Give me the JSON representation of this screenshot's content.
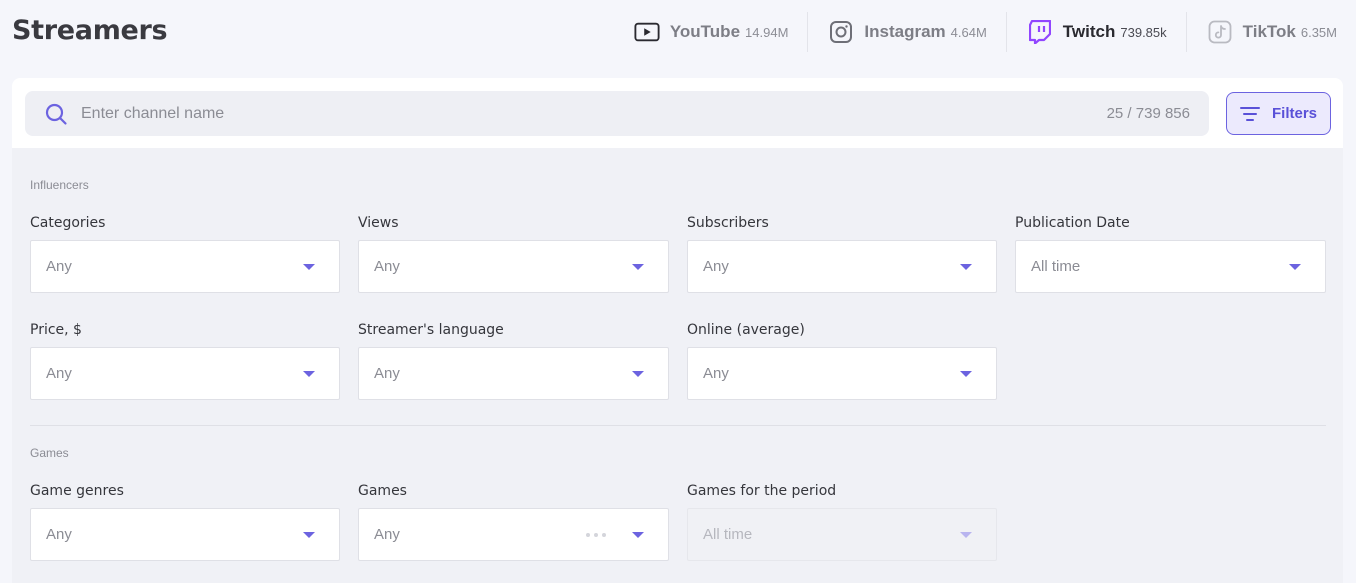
{
  "page_title": "Streamers",
  "platforms": [
    {
      "name": "YouTube",
      "count": "14.94M",
      "icon": "youtube-icon",
      "active": false
    },
    {
      "name": "Instagram",
      "count": "4.64M",
      "icon": "instagram-icon",
      "active": false
    },
    {
      "name": "Twitch",
      "count": "739.85k",
      "icon": "twitch-icon",
      "active": true
    },
    {
      "name": "TikTok",
      "count": "6.35M",
      "icon": "tiktok-icon",
      "active": false
    }
  ],
  "search": {
    "placeholder": "Enter channel name",
    "value": "",
    "count": "25 / 739 856"
  },
  "filters_button": {
    "label": "Filters",
    "accent": "#6c63e0"
  },
  "influencers": {
    "section_label": "Influencers",
    "fields": [
      {
        "label": "Categories",
        "value": "Any"
      },
      {
        "label": "Views",
        "value": "Any"
      },
      {
        "label": "Subscribers",
        "value": "Any"
      },
      {
        "label": "Publication Date",
        "value": "All time"
      },
      {
        "label": "Price, $",
        "value": "Any"
      },
      {
        "label": "Streamer's language",
        "value": "Any"
      },
      {
        "label": "Online (average)",
        "value": "Any"
      }
    ]
  },
  "games": {
    "section_label": "Games",
    "fields": [
      {
        "label": "Game genres",
        "value": "Any"
      },
      {
        "label": "Games",
        "value": "Any"
      },
      {
        "label": "Games for the period",
        "value": "All time",
        "disabled": true
      }
    ]
  }
}
